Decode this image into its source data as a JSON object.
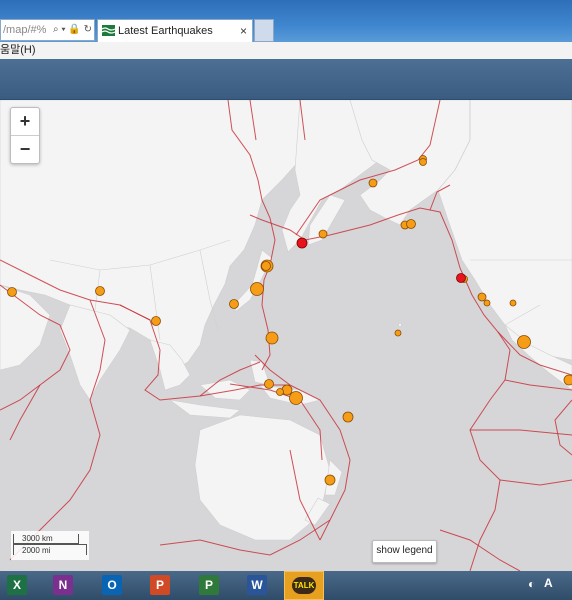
{
  "browser": {
    "address_fragment": "/map/#%",
    "tab_title": "Latest Earthquakes",
    "tab_close": "×",
    "menu_fragment": "움말(H)"
  },
  "map": {
    "zoom_in": "+",
    "zoom_out": "−",
    "scale_km": "3000 km",
    "scale_mi": "2000 mi",
    "legend_button": "show legend",
    "marker_colors": {
      "orange": "#f59d16",
      "red": "#e8141b",
      "outline": "#8a4a00"
    }
  },
  "taskbar": {
    "apps": [
      {
        "name": "excel-icon",
        "letter": "X",
        "color": "#1e7145"
      },
      {
        "name": "onenote-icon",
        "letter": "N",
        "color": "#7b2f8f"
      },
      {
        "name": "outlook-icon",
        "letter": "O",
        "color": "#0a64b4"
      },
      {
        "name": "powerpoint-icon",
        "letter": "P",
        "color": "#d04a26"
      },
      {
        "name": "project-icon",
        "letter": "P",
        "color": "#2f7a3a"
      },
      {
        "name": "word-icon",
        "letter": "W",
        "color": "#2a5699"
      }
    ],
    "talk_label": "TALK",
    "ime_label": "A"
  }
}
